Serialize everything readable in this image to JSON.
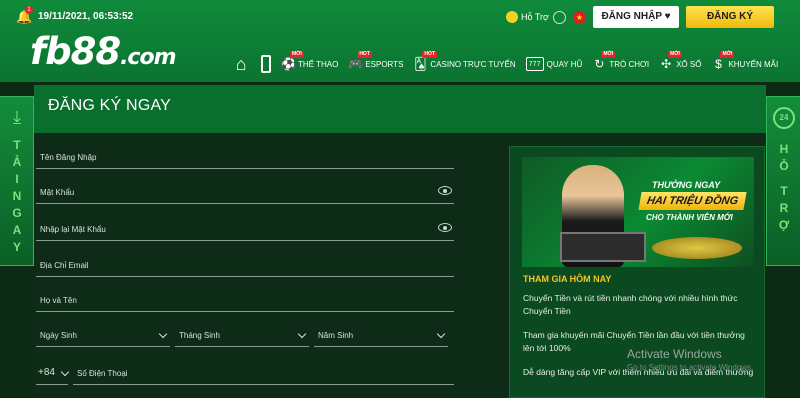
{
  "header": {
    "datetime": "19/11/2021, 06:53:52",
    "notification_count": "1",
    "logo_main": "fb88",
    "logo_suffix": ".com",
    "support_label": "Hỗ Trợ",
    "login_label": "ĐĂNG NHẬP ♥",
    "register_label": "ĐĂNG KÝ"
  },
  "nav": {
    "items": [
      {
        "label": "",
        "icon": "home-icon"
      },
      {
        "label": "",
        "icon": "mobile-icon"
      },
      {
        "label": "THỂ THAO",
        "icon": "soccer-icon",
        "tag": "MỚI"
      },
      {
        "label": "ESPORTS",
        "icon": "gamepad-icon",
        "tag": "HOT"
      },
      {
        "label": "CASINO TRỰC TUYẾN",
        "icon": "cards-icon",
        "tag": "HOT"
      },
      {
        "label": "QUAY HŨ",
        "icon": "slot-icon",
        "slot_text": "777"
      },
      {
        "label": "TRÒ CHƠI",
        "icon": "games-icon",
        "tag": "MỚI"
      },
      {
        "label": "XỔ SỐ",
        "icon": "lottery-icon",
        "tag": "MỚI"
      },
      {
        "label": "KHUYẾN MÃI",
        "icon": "promo-icon",
        "tag": "MỚI"
      }
    ]
  },
  "side": {
    "left_text": [
      "T",
      "Ả",
      "I",
      "N",
      "G",
      "A",
      "Y"
    ],
    "right_text": [
      "H",
      "Ỗ",
      "T",
      "R",
      "Ợ"
    ],
    "right_badge": "24"
  },
  "page": {
    "title": "ĐĂNG KÝ NGAY"
  },
  "form": {
    "username": "Tên Đăng Nhập",
    "password": "Mật Khẩu",
    "confirm_password": "Nhập lại Mật Khẩu",
    "email": "Địa Chỉ Email",
    "fullname": "Họ và Tên",
    "dob_day": "Ngày Sinh",
    "dob_month": "Tháng Sinh",
    "dob_year": "Năm Sinh",
    "country_code": "+84",
    "phone": "Số Điện Thoại"
  },
  "promo": {
    "banner_line1": "THƯỞNG NGAY",
    "banner_line2": "HAI TRIỆU ĐỒNG",
    "banner_line3": "CHO THÀNH VIÊN MỚI",
    "heading": "THAM GIA HÔM NAY",
    "paragraphs": [
      "Chuyển Tiền và rút tiền nhanh chóng với nhiều hình thức Chuyển Tiền",
      "Tham gia khuyến mãi Chuyển Tiền lần đầu với tiền thưởng lên tới 100%",
      "Dễ dàng tăng cấp VIP với thêm nhiều ưu đãi và điểm thưởng"
    ]
  },
  "watermark": {
    "title": "Activate Windows",
    "subtitle": "Go to Settings to activate Windows."
  }
}
